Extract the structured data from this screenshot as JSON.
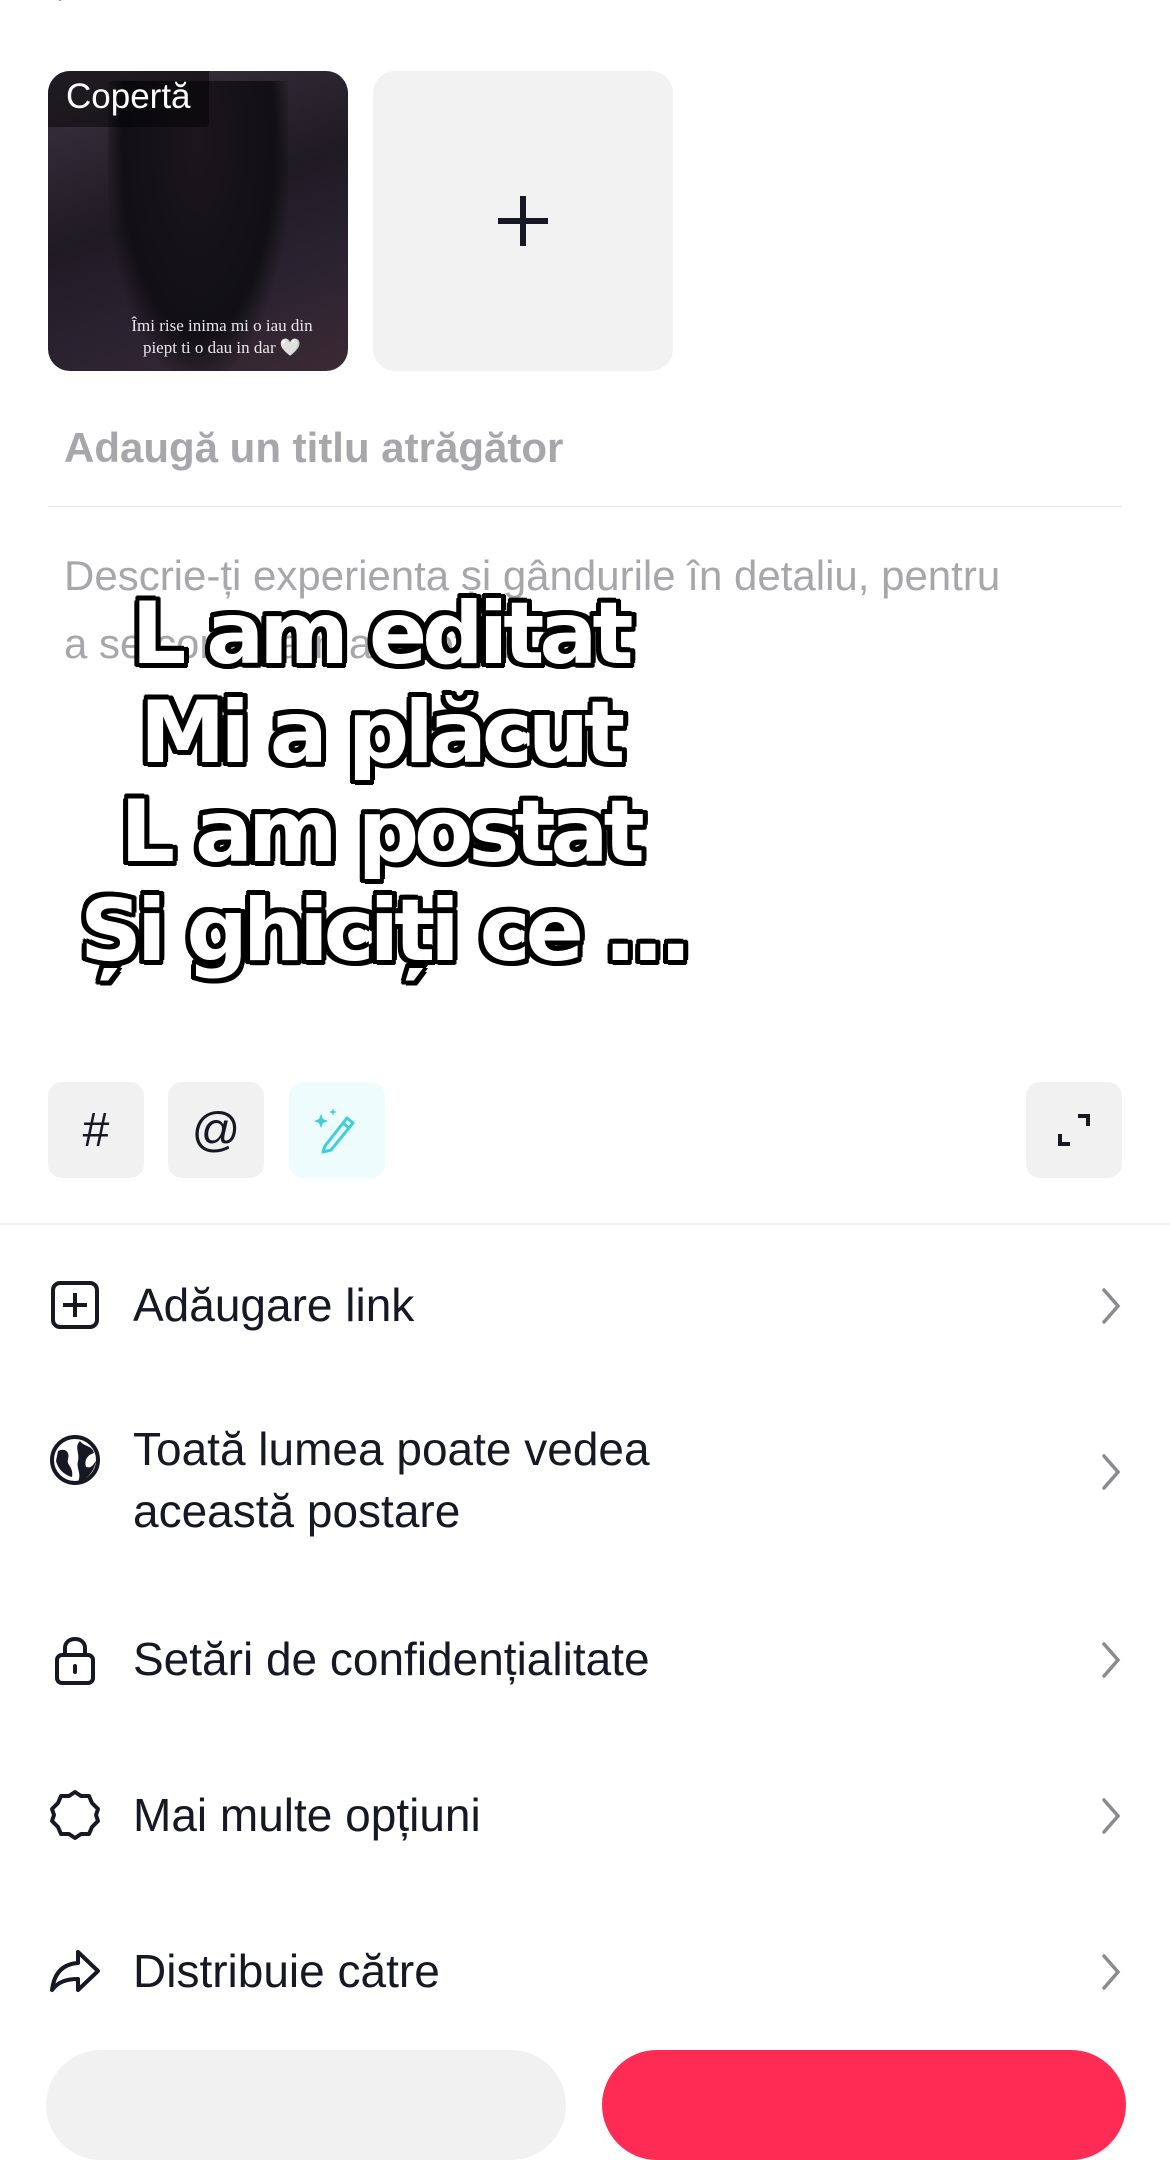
{
  "media": {
    "cover_label": "Copertă",
    "quote": "Îmi rise inima mi o iau din piept ti o dau in dar 🤍"
  },
  "title_placeholder": "Adaugă un titlu atrăgător",
  "description_placeholder": "Descrie-ți experienta și gândurile în detaliu, pentru a se conecta mai profundă.",
  "overlay_lines": [
    "L am editat",
    "Mi a plăcut",
    "L am postat",
    "Și ghiciți ce ..."
  ],
  "tools": {
    "hashtag": "#",
    "mention": "@"
  },
  "menu": [
    {
      "label": "Adăugare link",
      "icon": "plus-square-icon"
    },
    {
      "label": "Toată lumea poate vedea această postare",
      "icon": "globe-icon"
    },
    {
      "label": "Setări de confidențialitate",
      "icon": "lock-icon"
    },
    {
      "label": "Mai multe opțiuni",
      "icon": "gear-icon"
    },
    {
      "label": "Distribuie către",
      "icon": "share-icon"
    }
  ],
  "colors": {
    "accent": "#fe2c55",
    "placeholder": "#a7a7ab",
    "ai_chip": "#3fcfd8"
  }
}
